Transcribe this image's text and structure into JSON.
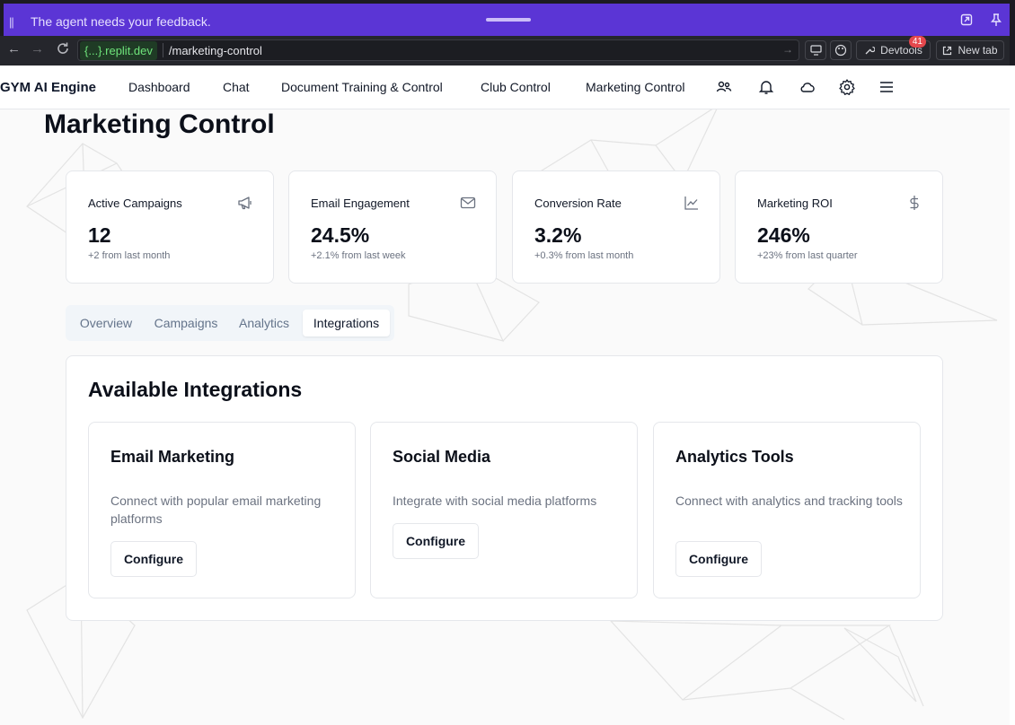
{
  "agent_banner": {
    "message": "The agent needs your feedback.",
    "pause_icon": "pause-icon",
    "icons": [
      "open-external-icon",
      "pin-icon"
    ]
  },
  "browser": {
    "url_host": "{...}.replit.dev",
    "url_path": "/marketing-control",
    "devtools_label": "Devtools",
    "devtools_badge": "41",
    "new_tab_label": "New tab"
  },
  "header": {
    "brand": "GYM AI Engine",
    "nav": [
      "Dashboard",
      "Chat",
      "Document Training & Control",
      "Club Control",
      "Marketing Control"
    ],
    "icons": [
      "users-icon",
      "bell-icon",
      "cloud-icon",
      "gear-icon",
      "menu-icon"
    ]
  },
  "page": {
    "title": "Marketing Control"
  },
  "stats": [
    {
      "label": "Active Campaigns",
      "value": "12",
      "sub": "+2 from last month",
      "icon": "megaphone-icon"
    },
    {
      "label": "Email Engagement",
      "value": "24.5%",
      "sub": "+2.1% from last week",
      "icon": "mail-icon"
    },
    {
      "label": "Conversion Rate",
      "value": "3.2%",
      "sub": "+0.3% from last month",
      "icon": "trend-chart-icon"
    },
    {
      "label": "Marketing ROI",
      "value": "246%",
      "sub": "+23% from last quarter",
      "icon": "dollar-icon"
    }
  ],
  "tabs": [
    {
      "label": "Overview",
      "active": false
    },
    {
      "label": "Campaigns",
      "active": false
    },
    {
      "label": "Analytics",
      "active": false
    },
    {
      "label": "Integrations",
      "active": true
    }
  ],
  "integrations": {
    "title": "Available Integrations",
    "items": [
      {
        "title": "Email Marketing",
        "description": "Connect with popular email marketing platforms",
        "button": "Configure"
      },
      {
        "title": "Social Media",
        "description": "Integrate with social media platforms",
        "button": "Configure"
      },
      {
        "title": "Analytics Tools",
        "description": "Connect with analytics and tracking tools",
        "button": "Configure"
      }
    ]
  },
  "colors": {
    "banner": "#5b35d5",
    "chrome": "#25262c",
    "url_host": "#6ee37a",
    "badge": "#e5484d"
  }
}
